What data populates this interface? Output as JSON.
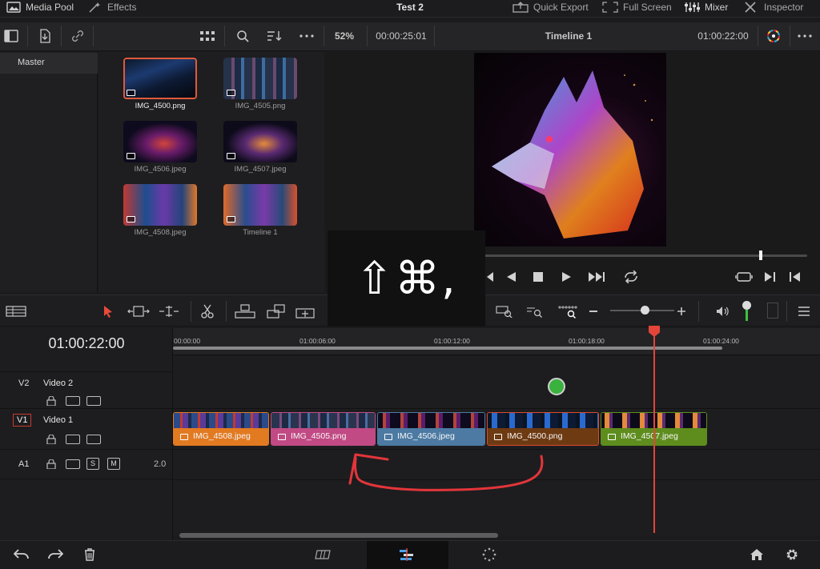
{
  "topbar": {
    "media_pool": "Media Pool",
    "effects": "Effects",
    "title": "Test 2",
    "quick_export": "Quick Export",
    "full_screen": "Full Screen",
    "mixer": "Mixer",
    "inspector": "Inspector"
  },
  "toolbar": {
    "zoom": "52%",
    "source_timecode": "00:00:25:01",
    "timeline_name": "Timeline 1",
    "record_timecode": "01:00:22:00"
  },
  "media_pool": {
    "bin": "Master",
    "items": [
      {
        "label": "IMG_4500.png"
      },
      {
        "label": "IMG_4505.png"
      },
      {
        "label": "IMG_4506.jpeg"
      },
      {
        "label": "IMG_4507.jpeg"
      },
      {
        "label": "IMG_4508.jpeg"
      },
      {
        "label": "Timeline 1"
      }
    ]
  },
  "overlay": {
    "shortcut": "⇧⌘,"
  },
  "timeline": {
    "timecode": "01:00:22:00",
    "ruler": [
      "00:00:00",
      "01:00:06:00",
      "01:00:12:00",
      "01:00:18:00",
      "01:00:24:00"
    ],
    "tracks": [
      {
        "id": "V2",
        "name": "Video 2"
      },
      {
        "id": "V1",
        "name": "Video 1"
      },
      {
        "id": "A1",
        "level": "2.0",
        "solo": "S",
        "mute": "M"
      }
    ],
    "clips": [
      {
        "name": "IMG_4508.jpeg",
        "color": "#e27a22"
      },
      {
        "name": "IMG_4505.png",
        "color": "#c14a84"
      },
      {
        "name": "IMG_4506.jpeg",
        "color": "#4c7aa2"
      },
      {
        "name": "IMG_4500.png",
        "color": "#6e3a12"
      },
      {
        "name": "IMG_4507.jpeg",
        "color": "#5e8d1e"
      }
    ]
  },
  "colors": {
    "accent": "#e3453a",
    "selection": "#e0593a"
  }
}
